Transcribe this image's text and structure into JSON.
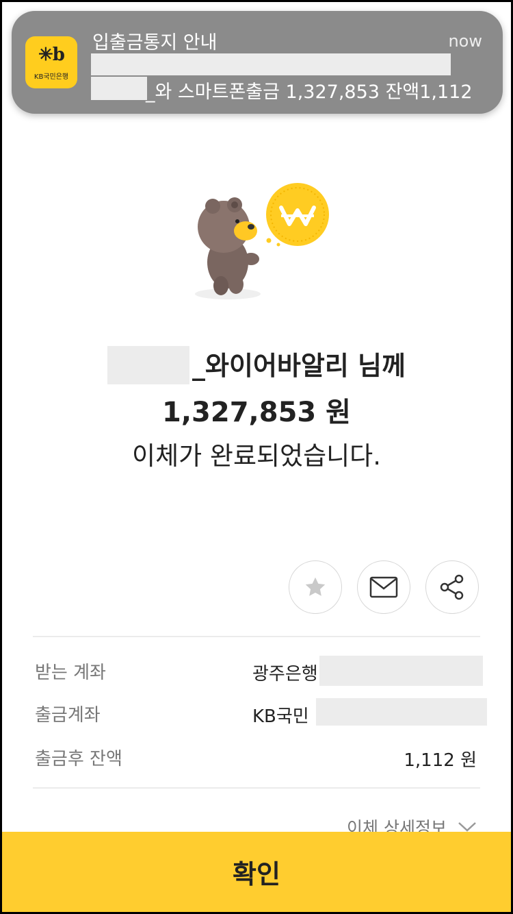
{
  "notification": {
    "logo_text": "KB국민은행",
    "title": "입출금통지 안내",
    "time": "now",
    "body": "_와  스마트폰출금 1,327,853 잔액1,112"
  },
  "transfer": {
    "recipient_suffix": "_와이어바알리 님께",
    "amount": "1,327,853 원",
    "status": "이체가 완료되었습니다."
  },
  "actions": {
    "favorite_icon": "star-icon",
    "message_icon": "mail-icon",
    "share_icon": "share-icon"
  },
  "details": {
    "receiving_account_label": "받는 계좌",
    "receiving_account_value": "광주은행",
    "withdrawal_account_label": "출금계좌",
    "withdrawal_account_value": "KB국민 ·",
    "balance_label": "출금후 잔액",
    "balance_value": "1,112 원",
    "more_info_label": "이체 상세정보"
  },
  "confirm_button": "확인",
  "colors": {
    "brand_yellow": "#ffcd2f",
    "notification_bg": "#8b8b8b"
  }
}
